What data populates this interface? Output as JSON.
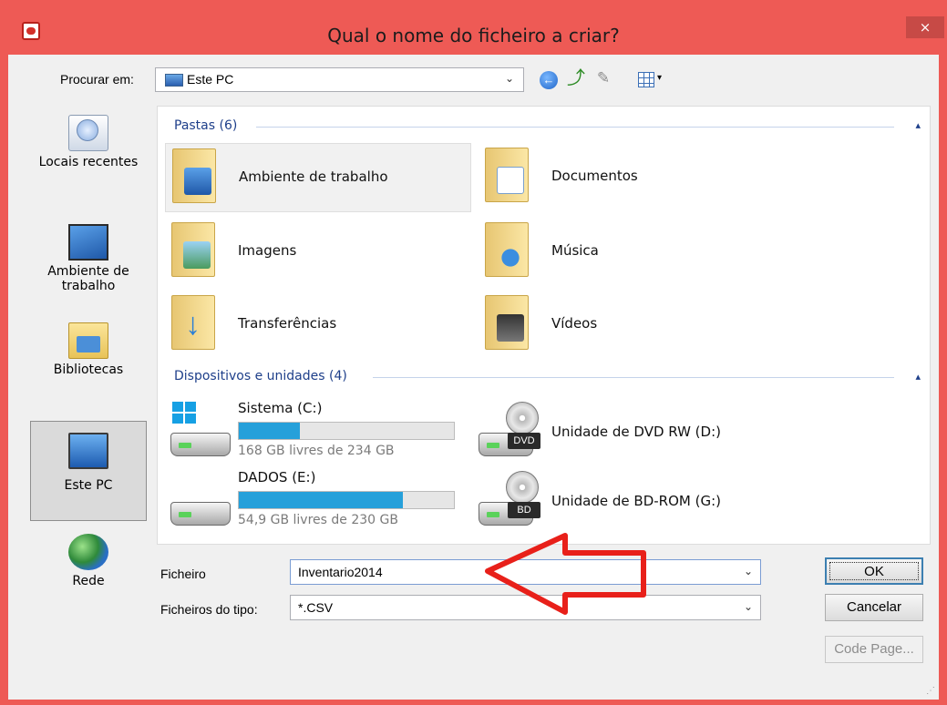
{
  "window": {
    "title": "Qual o nome do ficheiro a criar?",
    "close_glyph": "×",
    "accent": "#ee5a55"
  },
  "toolbar": {
    "lookin_label": "Procurar em:",
    "lookin_value": "Este PC",
    "dropdown_glyph": "⌄",
    "back_glyph": "←",
    "up_glyph": "⤴",
    "newfolder_glyph": "✎",
    "view_menu_glyph": "▾"
  },
  "places": [
    {
      "label": "Locais recentes",
      "icon": "recent-places-icon"
    },
    {
      "label": "Ambiente de\ntrabalho",
      "icon": "desktop-icon"
    },
    {
      "label": "Bibliotecas",
      "icon": "libraries-icon"
    },
    {
      "label": "Este PC",
      "icon": "this-pc-icon",
      "selected": true
    },
    {
      "label": "Rede",
      "icon": "network-icon"
    }
  ],
  "groups": {
    "folders_header": "Pastas (6)",
    "drives_header": "Dispositivos e unidades (4)",
    "collapse_glyph": "▴"
  },
  "folders": [
    {
      "name": "Ambiente de trabalho",
      "icon": "desktop-folder-icon"
    },
    {
      "name": "Documentos",
      "icon": "documents-folder-icon"
    },
    {
      "name": "Imagens",
      "icon": "pictures-folder-icon"
    },
    {
      "name": "Música",
      "icon": "music-folder-icon"
    },
    {
      "name": "Transferências",
      "icon": "downloads-folder-icon"
    },
    {
      "name": "Vídeos",
      "icon": "videos-folder-icon"
    }
  ],
  "drives": [
    {
      "name": "Sistema (C:)",
      "free_text": "168 GB livres de 234 GB",
      "used_fraction": 0.282,
      "icon": "system-drive-icon"
    },
    {
      "name": "Unidade de DVD RW (D:)",
      "badge": "DVD",
      "icon": "dvd-drive-icon"
    },
    {
      "name": "DADOS (E:)",
      "free_text": "54,9 GB livres de 230 GB",
      "used_fraction": 0.761,
      "icon": "hard-drive-icon"
    },
    {
      "name": "Unidade de BD-ROM (G:)",
      "badge": "BD",
      "icon": "bd-drive-icon"
    }
  ],
  "form": {
    "filename_label": "Ficheiro",
    "filename_value": "Inventario2014",
    "filetype_label": "Ficheiros do tipo:",
    "filetype_value": "*.CSV",
    "ok_label": "OK",
    "cancel_label": "Cancelar",
    "codepage_label": "Code Page..."
  },
  "annotation": {
    "arrow_color": "#e8201a"
  }
}
